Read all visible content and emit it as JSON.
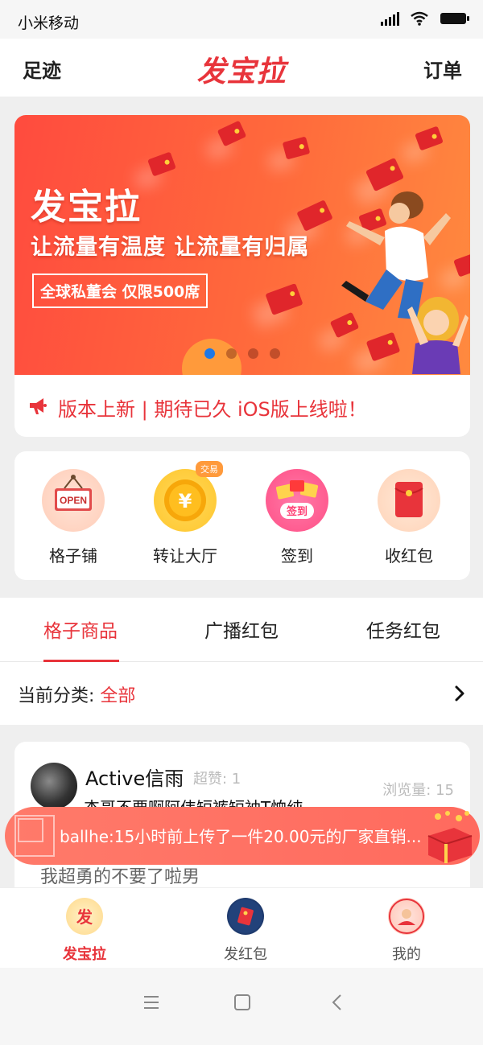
{
  "status_bar": {
    "carrier": "小米移动"
  },
  "header": {
    "left": "足迹",
    "logo": "发宝拉",
    "right": "订单"
  },
  "banner": {
    "title": "发宝拉",
    "slogan": "让流量有温度 让流量有归属",
    "badge": "全球私董会 仅限500席",
    "slides": 4,
    "active_slide": 1
  },
  "notice": {
    "icon": "megaphone-icon",
    "text": "版本上新 | 期待已久 iOS版上线啦！"
  },
  "quick_actions": [
    {
      "label": "格子铺",
      "icon": "open-sign-icon"
    },
    {
      "label": "转让大厅",
      "icon": "coin-icon",
      "badge": "交易"
    },
    {
      "label": "签到",
      "icon": "checkin-icon"
    },
    {
      "label": "收红包",
      "icon": "red-packet-icon"
    }
  ],
  "tabs": [
    {
      "label": "格子商品",
      "active": true
    },
    {
      "label": "广播红包",
      "active": false
    },
    {
      "label": "任务红包",
      "active": false
    }
  ],
  "category": {
    "label": "当前分类: ",
    "value": "全部"
  },
  "post": {
    "name": "Active信雨",
    "likes": "超赞: 1",
    "views": "浏览量: 15",
    "description": "杰哥不要啊阿伟短裤短袖T恤纯",
    "subtext": "我超勇的不要了啦男"
  },
  "toast": {
    "text": "ballhe:15小时前上传了一件20.00元的厂家直销..."
  },
  "bottom_nav": [
    {
      "label": "发宝拉",
      "active": true
    },
    {
      "label": "发红包",
      "active": false
    },
    {
      "label": "我的",
      "active": false
    }
  ],
  "colors": {
    "accent": "#e8343b",
    "banner": "#ff5a3c",
    "badge": "#ff9a3b"
  }
}
